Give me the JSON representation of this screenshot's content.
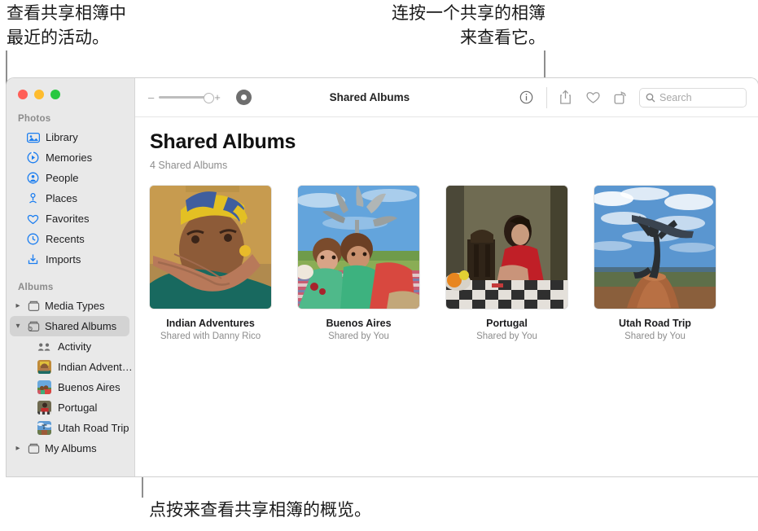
{
  "callouts": {
    "activity": "查看共享相簿中\n最近的活动。",
    "open_album": "连按一个共享的相簿\n来查看它。",
    "overview": "点按来查看共享相簿的概览。"
  },
  "window": {
    "traffic_lights": [
      "close",
      "minimize",
      "zoom"
    ]
  },
  "toolbar": {
    "zoom_out_label": "–",
    "zoom_in_label": "+",
    "record_button_name": "toggle-view-button",
    "title": "Shared Albums",
    "info_icon": "info-circle-icon",
    "share_icon": "share-icon",
    "favorite_icon": "heart-icon",
    "rotate_icon": "rotate-icon",
    "search": {
      "icon": "search-icon",
      "placeholder": "Search",
      "value": ""
    }
  },
  "sidebar": {
    "sections": [
      {
        "title": "Photos",
        "items": [
          {
            "label": "Library",
            "icon": "library-icon"
          },
          {
            "label": "Memories",
            "icon": "memories-icon"
          },
          {
            "label": "People",
            "icon": "people-icon"
          },
          {
            "label": "Places",
            "icon": "places-pin-icon"
          },
          {
            "label": "Favorites",
            "icon": "heart-icon"
          },
          {
            "label": "Recents",
            "icon": "clock-icon"
          },
          {
            "label": "Imports",
            "icon": "import-icon"
          }
        ]
      },
      {
        "title": "Albums",
        "groups": [
          {
            "label": "Media Types",
            "expanded": false,
            "selected": false,
            "icon": "album-icon"
          },
          {
            "label": "Shared Albums",
            "expanded": true,
            "selected": true,
            "icon": "shared-album-icon"
          },
          {
            "label": "My Albums",
            "expanded": false,
            "selected": false,
            "icon": "album-icon"
          }
        ],
        "shared_children": [
          {
            "label": "Activity",
            "icon": "people-group-icon"
          },
          {
            "label": "Indian Advent…",
            "icon": "album-thumbnail"
          },
          {
            "label": "Buenos Aires",
            "icon": "album-thumbnail"
          },
          {
            "label": "Portugal",
            "icon": "album-thumbnail"
          },
          {
            "label": "Utah Road Trip",
            "icon": "album-thumbnail"
          }
        ]
      }
    ]
  },
  "main": {
    "heading": "Shared Albums",
    "subheading": "4 Shared Albums",
    "albums": [
      {
        "name": "Indian Adventures",
        "shared": "Shared with Danny Rico"
      },
      {
        "name": "Buenos Aires",
        "shared": "Shared by You"
      },
      {
        "name": "Portugal",
        "shared": "Shared by You"
      },
      {
        "name": "Utah Road Trip",
        "shared": "Shared by You"
      }
    ]
  },
  "colors": {
    "accent": "#1a7df0",
    "sidebar_bg": "#e9e9e9",
    "selected_row": "#d3d3d3",
    "leader_line": "#8e8e8e"
  }
}
